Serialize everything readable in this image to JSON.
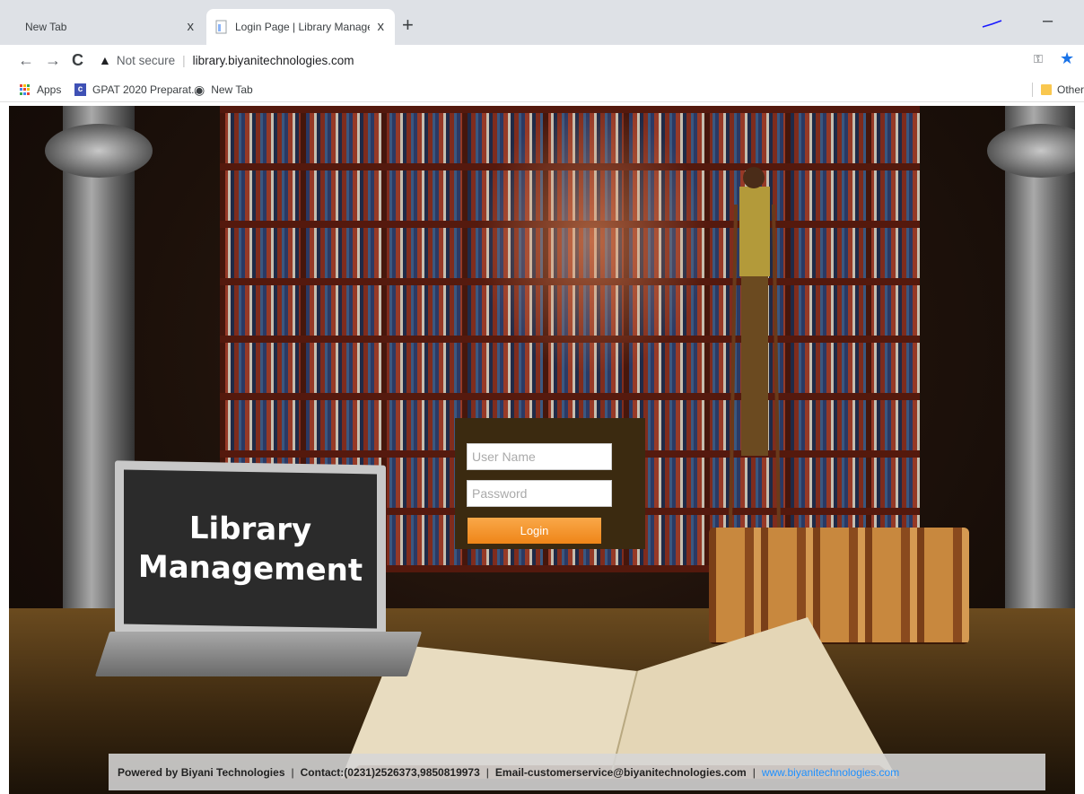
{
  "browser": {
    "tabs": [
      {
        "title": "New Tab",
        "active": false
      },
      {
        "title": "Login Page | Library Management",
        "active": true
      }
    ],
    "new_tab_symbol": "+",
    "close_symbol": "x",
    "minimize_symbol": "–",
    "nav": {
      "back": "←",
      "forward": "→",
      "reload": "C"
    },
    "security_label": "Not secure",
    "url": "library.biyanitechnologies.com",
    "bookmarks": [
      {
        "label": "Apps",
        "icon": "apps-grid-icon"
      },
      {
        "label": "GPAT 2020 Preparat...",
        "icon": "c-icon"
      },
      {
        "label": "New Tab",
        "icon": "globe-icon"
      }
    ],
    "other_bookmarks": "Other"
  },
  "page": {
    "laptop_title_line1": "Library",
    "laptop_title_line2": "Management",
    "login": {
      "username_placeholder": "User Name",
      "password_placeholder": "Password",
      "button_label": "Login"
    },
    "footer": {
      "powered_by": "Powered by Biyani Technologies",
      "contact": "Contact:(0231)2526373,9850819973",
      "email": "Email-customerservice@biyanitechnologies.com",
      "website": "www.biyanitechnologies.com",
      "separator": "|"
    }
  },
  "colors": {
    "login_box_bg": "#3b2a10",
    "login_button": "#f39a2e",
    "link_blue": "#1e90ff",
    "chrome_star": "#1a73e8"
  }
}
